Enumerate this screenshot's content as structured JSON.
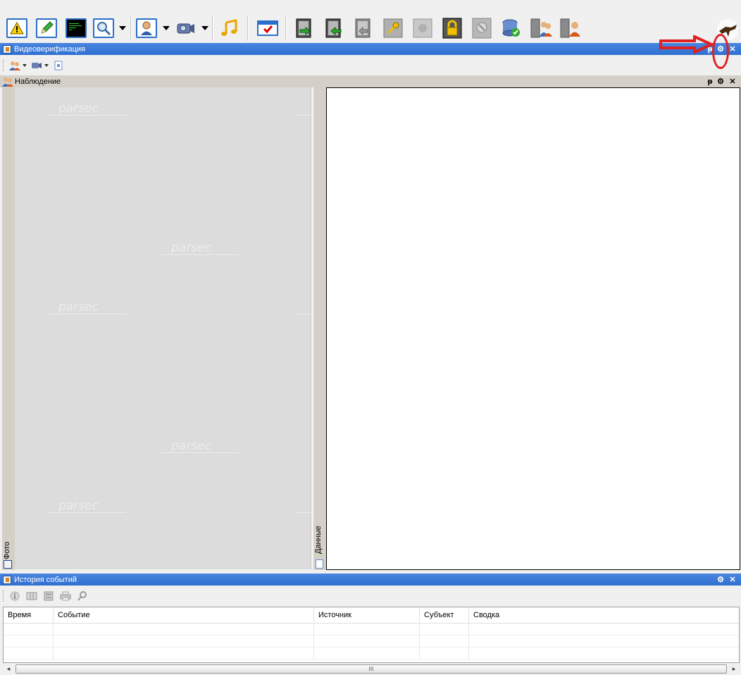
{
  "toolbar": {
    "buttons": [
      {
        "name": "alarm-button",
        "icon": "warning-icon"
      },
      {
        "name": "edit-button",
        "icon": "pencil-icon"
      },
      {
        "name": "monitor-button",
        "icon": "terminal-icon"
      },
      {
        "name": "search-button",
        "icon": "magnifier-icon"
      },
      {
        "name": "person-button",
        "icon": "person-icon"
      },
      {
        "name": "camera-button",
        "icon": "camera-icon"
      },
      {
        "name": "sound-button",
        "icon": "music-note-icon"
      },
      {
        "name": "check-button",
        "icon": "checkbox-icon"
      },
      {
        "name": "door-enter-button",
        "icon": "door-enter-icon"
      },
      {
        "name": "door-exit-button",
        "icon": "door-exit-icon"
      },
      {
        "name": "door-open-button",
        "icon": "door-open-icon"
      },
      {
        "name": "key-button",
        "icon": "key-icon"
      },
      {
        "name": "disabled-button",
        "icon": "blocked-icon"
      },
      {
        "name": "lock-button",
        "icon": "lock-icon"
      },
      {
        "name": "guard-button",
        "icon": "guard-icon"
      },
      {
        "name": "database-button",
        "icon": "database-check-icon"
      },
      {
        "name": "users-door-button",
        "icon": "users-door-icon"
      },
      {
        "name": "user-door-button",
        "icon": "user-door-icon"
      }
    ]
  },
  "video_panel": {
    "title": "Видеоверификация",
    "pin_glyph": "ᵽ",
    "gear_glyph": "⚙",
    "close_glyph": "✕"
  },
  "observation": {
    "title": "Наблюдение",
    "photo_tab": "Фото",
    "data_tab": "Данные",
    "watermark": "parsec"
  },
  "history": {
    "title": "История событий",
    "columns": [
      "Время",
      "Событие",
      "Источник",
      "Субъект",
      "Сводка"
    ],
    "scroll_thumb": "III",
    "scroll_left": "◂",
    "scroll_right": "▸"
  },
  "colors": {
    "title_bar": "#2f6fd1",
    "annotation": "#e02020"
  }
}
